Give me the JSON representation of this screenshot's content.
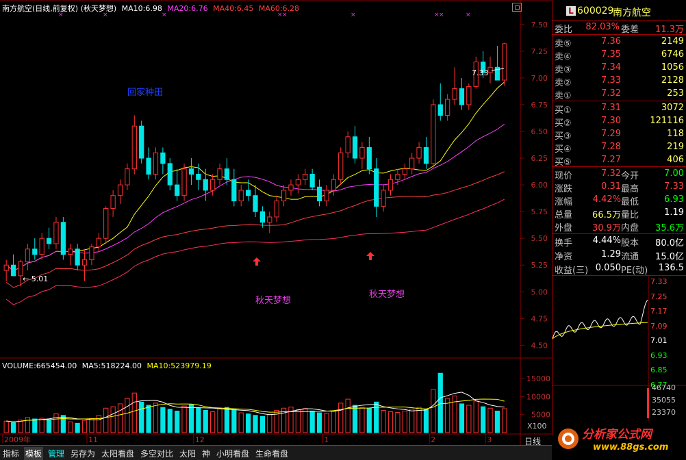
{
  "header": {
    "title": "南方航空(日线,前复权) (秋天梦想)",
    "ma10": "MA10:6.98",
    "ma20": "MA20:6.76",
    "ma40": "MA40:6.45",
    "ma60": "MA60:6.28",
    "restore_icon": "window-restore-icon"
  },
  "annotations": {
    "top_text": "回家种田",
    "sig1": "秋天梦想",
    "sig2": "秋天梦想",
    "low_label": "← 5.01",
    "high_label": "7.33"
  },
  "volume_header": {
    "volume": "VOLUME:665454.00",
    "ma5": "MA5:518224.00",
    "ma10": "MA10:523979.19"
  },
  "price_axis": [
    "7.50",
    "7.25",
    "7.00",
    "6.75",
    "6.50",
    "6.25",
    "6.00",
    "5.75",
    "5.50",
    "5.25",
    "5.00",
    "4.75",
    "4.50"
  ],
  "volume_axis": [
    "15000",
    "10000",
    "5000"
  ],
  "volume_unit": "X100",
  "date_axis": [
    "2009年",
    "11",
    "12",
    "1",
    "2",
    "3"
  ],
  "quote": {
    "code": "600029",
    "name": "南方航空",
    "logo_letter": "L",
    "weibi_label": "委比",
    "weibi": "82.03%",
    "weicha_label": "委差",
    "weicha": "11.3万",
    "asks": [
      {
        "label": "卖⑤",
        "price": "7.36",
        "vol": "2149"
      },
      {
        "label": "卖④",
        "price": "7.35",
        "vol": "6746"
      },
      {
        "label": "卖③",
        "price": "7.34",
        "vol": "1056"
      },
      {
        "label": "卖②",
        "price": "7.33",
        "vol": "2128"
      },
      {
        "label": "卖①",
        "price": "7.32",
        "vol": "253"
      }
    ],
    "bids": [
      {
        "label": "买①",
        "price": "7.31",
        "vol": "3072"
      },
      {
        "label": "买②",
        "price": "7.30",
        "vol": "121116"
      },
      {
        "label": "买③",
        "price": "7.29",
        "vol": "118"
      },
      {
        "label": "买④",
        "price": "7.28",
        "vol": "219"
      },
      {
        "label": "买⑤",
        "price": "7.27",
        "vol": "406"
      }
    ],
    "stats": [
      {
        "l1": "现价",
        "v1": "7.32",
        "c1": "#ff4040",
        "l2": "今开",
        "v2": "7.00",
        "c2": "#00ff00"
      },
      {
        "l1": "涨跌",
        "v1": "0.31",
        "c1": "#ff4040",
        "l2": "最高",
        "v2": "7.33",
        "c2": "#ff4040"
      },
      {
        "l1": "涨幅",
        "v1": "4.42%",
        "c1": "#ff4040",
        "l2": "最低",
        "v2": "6.93",
        "c2": "#00ff00"
      },
      {
        "l1": "总量",
        "v1": "66.5万",
        "c1": "#ffff60",
        "l2": "量比",
        "v2": "1.19",
        "c2": "#ffffff"
      },
      {
        "l1": "外盘",
        "v1": "30.9万",
        "c1": "#ff4040",
        "l2": "内盘",
        "v2": "35.6万",
        "c2": "#00ff00"
      }
    ],
    "stats2": [
      {
        "l1": "换手",
        "v1": "4.44%",
        "l2": "股本",
        "v2": "80.0亿"
      },
      {
        "l1": "净资",
        "v1": "1.29",
        "l2": "流通",
        "v2": "15.0亿"
      },
      {
        "l1": "收益(三)",
        "v1": "0.050",
        "l2": "PE(动)",
        "v2": "136.5"
      }
    ]
  },
  "mini_chart": {
    "price_axis": [
      "7.33",
      "7.25",
      "7.17",
      "7.09",
      "7.01",
      "6.93",
      "6.85",
      "6.77"
    ],
    "volume_axis": [
      "46740",
      "35055",
      "23370"
    ]
  },
  "bottom_tabs": [
    "指标",
    "模板",
    "管理",
    "另存为",
    "太阳看盘",
    "多空对比",
    "太阳",
    "神",
    "小明看盘",
    "生命看盘"
  ],
  "period_tab": "日线",
  "logo": {
    "name": "分析家公式网",
    "url": "www.88gs.com"
  },
  "colors": {
    "up": "#ff3232",
    "down": "#00e5e5",
    "ma10": "#ffffff",
    "ma20": "#ffff00",
    "ma40": "#ff40ff",
    "ma60": "#ff4040",
    "grid": "#8b0000"
  },
  "chart_data": {
    "type": "candlestick",
    "price_range": [
      4.4,
      7.55
    ],
    "volume_range": [
      0,
      17500
    ],
    "candles": [
      [
        5.2,
        5.3,
        5.1,
        5.25
      ],
      [
        5.25,
        5.35,
        5.2,
        5.15
      ],
      [
        5.15,
        5.3,
        5.05,
        5.28
      ],
      [
        5.28,
        5.45,
        5.2,
        5.4
      ],
      [
        5.4,
        5.5,
        5.3,
        5.35
      ],
      [
        5.35,
        5.55,
        5.3,
        5.5
      ],
      [
        5.5,
        5.6,
        5.4,
        5.45
      ],
      [
        5.45,
        5.7,
        5.4,
        5.65
      ],
      [
        5.65,
        5.7,
        5.3,
        5.35
      ],
      [
        5.35,
        5.45,
        5.25,
        5.4
      ],
      [
        5.4,
        5.45,
        5.2,
        5.25
      ],
      [
        5.25,
        5.4,
        5.1,
        5.3
      ],
      [
        5.3,
        5.45,
        5.25,
        5.42
      ],
      [
        5.42,
        5.55,
        5.38,
        5.5
      ],
      [
        5.5,
        5.8,
        5.45,
        5.78
      ],
      [
        5.78,
        5.95,
        5.7,
        5.9
      ],
      [
        5.9,
        6.05,
        5.82,
        6.0
      ],
      [
        6.0,
        6.2,
        5.95,
        6.15
      ],
      [
        6.15,
        6.65,
        6.1,
        6.55
      ],
      [
        6.55,
        6.6,
        6.2,
        6.25
      ],
      [
        6.25,
        6.35,
        6.05,
        6.1
      ],
      [
        6.1,
        6.35,
        6.05,
        6.3
      ],
      [
        6.3,
        6.35,
        6.1,
        6.2
      ],
      [
        6.2,
        6.25,
        5.95,
        6.0
      ],
      [
        6.0,
        6.15,
        5.85,
        5.9
      ],
      [
        5.9,
        6.2,
        5.85,
        6.15
      ],
      [
        6.15,
        6.25,
        6.0,
        6.1
      ],
      [
        6.1,
        6.2,
        5.95,
        6.05
      ],
      [
        6.05,
        6.15,
        5.85,
        5.95
      ],
      [
        5.95,
        6.1,
        5.9,
        6.05
      ],
      [
        6.05,
        6.2,
        6.0,
        6.15
      ],
      [
        6.15,
        6.25,
        6.0,
        6.05
      ],
      [
        6.05,
        6.15,
        5.8,
        5.85
      ],
      [
        5.85,
        6.0,
        5.8,
        5.95
      ],
      [
        5.95,
        6.05,
        5.85,
        5.9
      ],
      [
        5.9,
        6.0,
        5.7,
        5.75
      ],
      [
        5.75,
        5.8,
        5.6,
        5.65
      ],
      [
        5.65,
        5.75,
        5.55,
        5.7
      ],
      [
        5.7,
        5.9,
        5.65,
        5.85
      ],
      [
        5.85,
        6.0,
        5.8,
        5.95
      ],
      [
        5.95,
        6.05,
        5.9,
        6.0
      ],
      [
        6.0,
        6.1,
        5.92,
        6.05
      ],
      [
        6.05,
        6.15,
        6.0,
        6.1
      ],
      [
        6.1,
        6.15,
        5.95,
        5.98
      ],
      [
        5.98,
        6.05,
        5.8,
        5.85
      ],
      [
        5.85,
        6.0,
        5.8,
        5.95
      ],
      [
        5.95,
        6.1,
        5.9,
        6.05
      ],
      [
        6.05,
        6.35,
        6.0,
        6.3
      ],
      [
        6.3,
        6.5,
        6.25,
        6.45
      ],
      [
        6.45,
        6.55,
        6.2,
        6.25
      ],
      [
        6.25,
        6.4,
        6.15,
        6.35
      ],
      [
        6.35,
        6.45,
        6.1,
        6.15
      ],
      [
        6.15,
        6.25,
        5.7,
        5.8
      ],
      [
        5.8,
        6.0,
        5.75,
        5.95
      ],
      [
        5.95,
        6.1,
        5.9,
        6.05
      ],
      [
        6.05,
        6.15,
        6.0,
        6.1
      ],
      [
        6.1,
        6.2,
        6.05,
        6.15
      ],
      [
        6.15,
        6.3,
        6.1,
        6.25
      ],
      [
        6.25,
        6.4,
        6.2,
        6.35
      ],
      [
        6.35,
        6.45,
        6.15,
        6.2
      ],
      [
        6.2,
        6.8,
        6.15,
        6.75
      ],
      [
        6.75,
        6.95,
        6.6,
        6.65
      ],
      [
        6.65,
        6.85,
        6.6,
        6.8
      ],
      [
        6.8,
        7.1,
        6.75,
        6.9
      ],
      [
        6.9,
        7.0,
        6.7,
        6.75
      ],
      [
        6.75,
        6.95,
        6.7,
        6.92
      ],
      [
        6.92,
        7.2,
        6.9,
        7.15
      ],
      [
        7.15,
        7.25,
        7.0,
        7.05
      ],
      [
        7.05,
        7.2,
        6.95,
        7.1
      ],
      [
        7.1,
        7.3,
        7.0,
        6.98
      ],
      [
        6.98,
        7.33,
        6.93,
        7.32
      ]
    ],
    "volumes": [
      3200,
      2800,
      3500,
      4200,
      3800,
      4000,
      3600,
      5200,
      4800,
      3000,
      2600,
      3400,
      3900,
      4800,
      6800,
      7200,
      8000,
      9500,
      11000,
      8500,
      7600,
      8200,
      7000,
      6500,
      6000,
      7400,
      7800,
      6900,
      6200,
      5800,
      6600,
      7000,
      6300,
      5500,
      5200,
      4800,
      4500,
      5000,
      6200,
      6800,
      7100,
      6400,
      6700,
      6000,
      5500,
      5400,
      6000,
      8200,
      9300,
      7600,
      7000,
      6800,
      8500,
      6200,
      5800,
      5600,
      6000,
      6500,
      7000,
      6400,
      12000,
      16500,
      9500,
      10200,
      8000,
      7600,
      8800,
      7200,
      6800,
      6000,
      6655
    ]
  }
}
